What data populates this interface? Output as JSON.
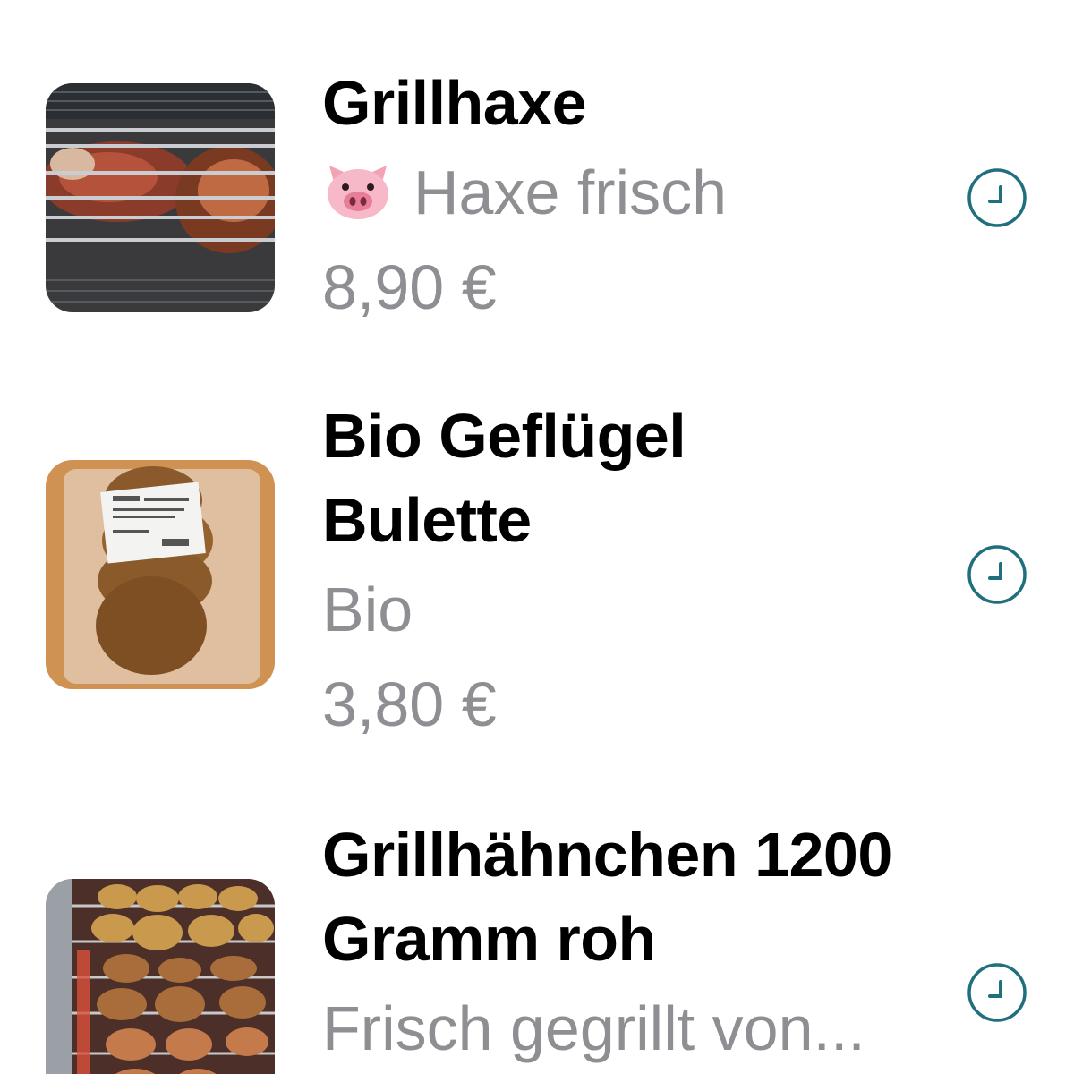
{
  "accent_color": "#1f6f7e",
  "products": [
    {
      "title": "Grillhaxe",
      "subtitle_icon": "pig-face-emoji",
      "subtitle": "Haxe frisch",
      "price": "8,90 €",
      "action_icon": "clock-icon"
    },
    {
      "title": "Bio Geflügel Bulette",
      "subtitle": "Bio",
      "price": "3,80 €",
      "action_icon": "clock-icon"
    },
    {
      "title": "Grillhähnchen 1200 Gramm roh",
      "subtitle": "Frisch gegrillt von...",
      "action_icon": "clock-icon"
    }
  ]
}
